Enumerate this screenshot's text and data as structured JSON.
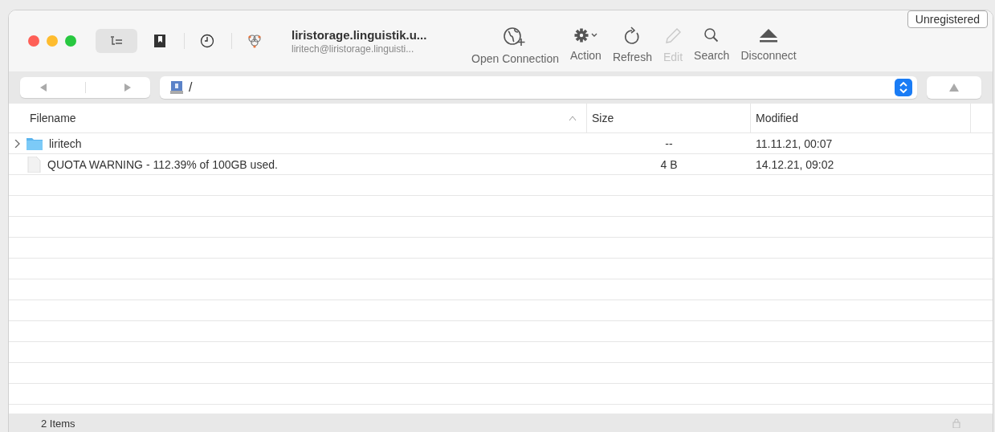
{
  "window": {
    "title": "liristorage.linguistik.u...",
    "subtitle": "liritech@liristorage.linguisti...",
    "badge": "Unregistered"
  },
  "view_toggles": [
    {
      "kind": "browser",
      "selected": true
    },
    {
      "kind": "bookmarks",
      "selected": false
    },
    {
      "kind": "history",
      "selected": false
    },
    {
      "kind": "bonjour",
      "selected": false
    }
  ],
  "toolbar": [
    {
      "kind": "open",
      "label": "Open Connection",
      "disabled": false
    },
    {
      "kind": "action",
      "label": "Action",
      "disabled": false
    },
    {
      "kind": "refresh",
      "label": "Refresh",
      "disabled": false
    },
    {
      "kind": "edit",
      "label": "Edit",
      "disabled": true
    },
    {
      "kind": "search",
      "label": "Search",
      "disabled": false
    },
    {
      "kind": "disconnect",
      "label": "Disconnect",
      "disabled": false
    }
  ],
  "path": "/",
  "table": {
    "columns": [
      "Filename",
      "Size",
      "Modified"
    ],
    "rows": [
      {
        "kind": "folder",
        "name": "liritech",
        "size": "--",
        "modified": "11.11.21, 00:07",
        "expanded": false
      },
      {
        "kind": "file",
        "name": "QUOTA WARNING - 112.39% of 100GB used.",
        "size": "4 B",
        "modified": "14.12.21, 09:02"
      }
    ]
  },
  "status_bar": "2 Items"
}
